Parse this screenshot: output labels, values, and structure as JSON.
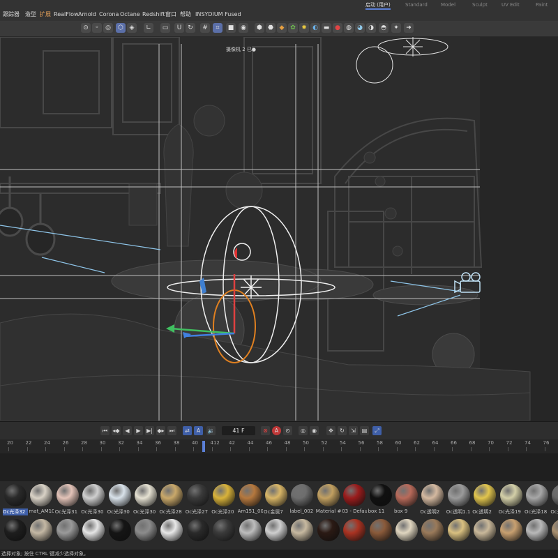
{
  "menu": {
    "items": [
      "跟踪器",
      "造型",
      "扩展",
      "RealFlow",
      "Arnold",
      "Corona",
      "Octane",
      "Redshift",
      "窗口",
      "帮助",
      "INSYDIUM Fused"
    ]
  },
  "layouts": {
    "tabs": [
      "启动 (用户)",
      "Standard",
      "Model",
      "Sculpt",
      "UV Edit",
      "Paint"
    ],
    "active": "启动 (用户)"
  },
  "viewport": {
    "camera_label": "摄像机 2 已●",
    "grid_color": "#bfbfbf",
    "wire_color": "#d8d8d8"
  },
  "timeline": {
    "current_frame": "41 F",
    "ruler_labels": [
      "20",
      "22",
      "24",
      "26",
      "28",
      "30",
      "32",
      "34",
      "36",
      "38",
      "40",
      "412",
      "42",
      "44",
      "46",
      "48",
      "50",
      "52",
      "54",
      "56",
      "58",
      "60",
      "62",
      "64",
      "66",
      "68",
      "70",
      "72",
      "74",
      "76",
      "78"
    ],
    "accent": "#5b7fd6"
  },
  "materials": {
    "row1": [
      "Oc光泽32",
      "mat_AM10",
      "Oc光泽31",
      "Oc光泽30",
      "Oc光泽30",
      "Oc光泽30",
      "Oc光泽28",
      "Oc光泽27",
      "Oc光泽20",
      "Am151_00",
      "Oc金属7",
      "label_002",
      "Material #",
      "03 - Defau",
      "box 11",
      "box 9",
      "Oc透明2",
      "Oc透明1.1",
      "Oc透明2",
      "Oc光泽19",
      "Oc光泽18",
      "Oc光泽"
    ],
    "row1_colors": [
      "#2a2a2a",
      "#d9d2c6",
      "#e3c3b8",
      "#cfcfcf",
      "#d9e2ea",
      "#e5e1d2",
      "#c9a86a",
      "#3a3a3a",
      "#d8b23a",
      "#b5783e",
      "#d9b667",
      "#6e6e6e",
      "#c2a061",
      "#9a1c1c",
      "#101010",
      "#b86a5a",
      "#d4b9a0",
      "#9b9b9b",
      "#e1c54e",
      "#d3cfa8",
      "#a7a7a7",
      "#6a6a6a"
    ],
    "row2_colors": [
      "#1e1e1e",
      "#c4b8a4",
      "#9a9a9a",
      "#e6e6e6",
      "#151515",
      "#8c8c8c",
      "#e8e8e8",
      "#2a2a2a",
      "#3a3a3a",
      "#bdbdbd",
      "#cfcfcf",
      "#c7b9a0",
      "#2b1a14",
      "#aa3322",
      "#8a5a3a",
      "#e0d6c0",
      "#9a7a5a",
      "#d9c080",
      "#c9b89a",
      "#c8a070",
      "#b9b9b9",
      "#a99070"
    ],
    "selected": "Oc光泽32"
  },
  "status": {
    "text": "选择对象; 按住 CTRL 键减少选择对象。"
  }
}
